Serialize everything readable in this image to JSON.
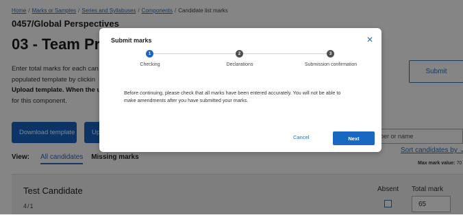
{
  "breadcrumb": {
    "items": [
      {
        "label": "Home",
        "link": true
      },
      {
        "label": "Marks or Samples",
        "link": true
      },
      {
        "label": "Series and Syllabuses",
        "link": true
      },
      {
        "label": "Components",
        "link": true
      },
      {
        "label": "Candidate list marks",
        "link": false
      }
    ],
    "separator": "/"
  },
  "page": {
    "subject": "0457/Global Perspectives",
    "title": "03 - Team Pro",
    "intro_lines": [
      "Enter total marks for each can",
      "populated template by clickin",
      "Upload template. When the u",
      "for this component."
    ],
    "submit_label": "Submit",
    "download_template_label": "Download template",
    "upload_label": "Up",
    "search_placeholder": "ber or name",
    "view_label": "View:",
    "tabs": [
      {
        "label": "All candidates",
        "active": true
      },
      {
        "label": "Missing marks",
        "active": false
      }
    ],
    "sort_label": "Sort candidates by",
    "sort_icon": "chevron-down-icon",
    "max_mark_label": "Max mark value:",
    "max_mark_value": "70"
  },
  "candidate": {
    "name": "Test Candidate",
    "number": "4/1",
    "absent_label": "Absent",
    "total_mark_label": "Total mark",
    "absent_checked": false,
    "total_mark_value": "65"
  },
  "modal": {
    "title": "Submit marks",
    "close_icon": "close-icon",
    "steps": [
      {
        "number": "1",
        "label": "Checking",
        "state": "active"
      },
      {
        "number": "2",
        "label": "Declarations",
        "state": "pending"
      },
      {
        "number": "3",
        "label": "Submission confirmation",
        "state": "pending"
      }
    ],
    "body_lines": [
      "Before continuing, please check that all marks have been entered accurately. You will not be able to",
      "make amendments after you have submitted your marks."
    ],
    "cancel_label": "Cancel",
    "next_label": "Next"
  },
  "colors": {
    "accent": "#1767c3",
    "link": "#2d6db4",
    "step_pending": "#505050",
    "overlay": "rgba(0,0,0,0.48)"
  }
}
